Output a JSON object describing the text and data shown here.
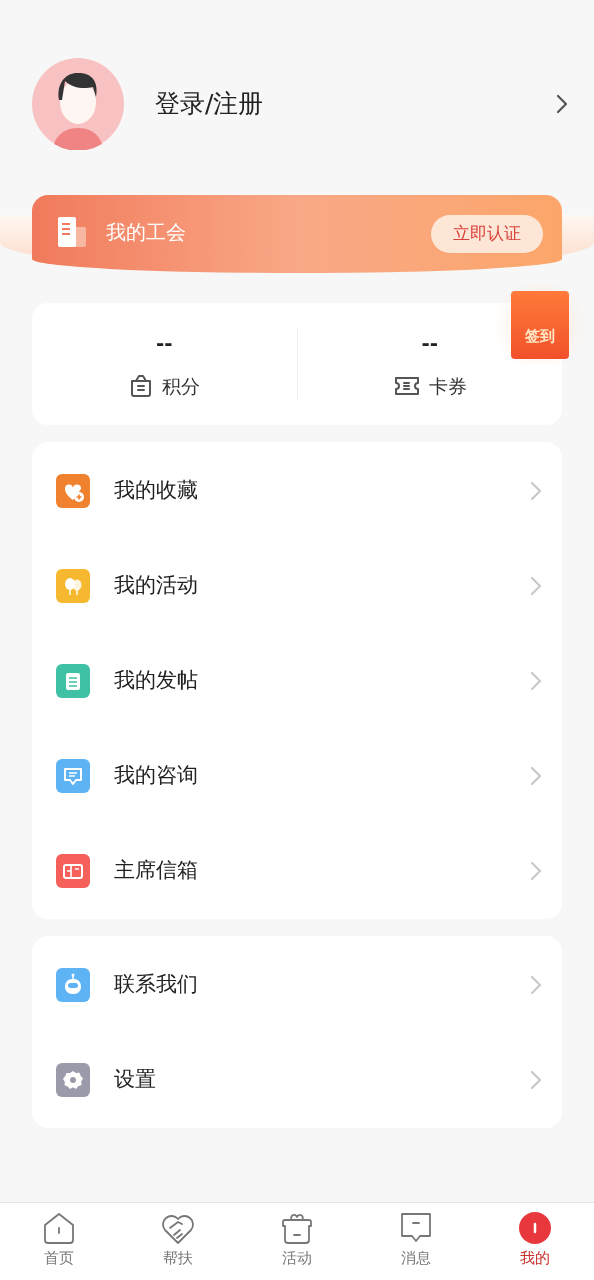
{
  "profile": {
    "login_label": "登录/注册"
  },
  "union_banner": {
    "title": "我的工会",
    "action": "立即认证"
  },
  "sign_in_badge": {
    "label": "签到"
  },
  "stats": [
    {
      "value": "--",
      "label": "积分",
      "kind": "bag"
    },
    {
      "value": "--",
      "label": "卡券",
      "kind": "ticket"
    }
  ],
  "menu_groups": [
    [
      {
        "label": "我的收藏",
        "kind": "heart",
        "color": "#f0812e"
      },
      {
        "label": "我的活动",
        "kind": "balloon",
        "color": "#f5b82e"
      },
      {
        "label": "我的发帖",
        "kind": "clipboard",
        "color": "#3fc1a5"
      },
      {
        "label": "我的咨询",
        "kind": "chat",
        "color": "#5eb3f5"
      },
      {
        "label": "主席信箱",
        "kind": "mailbox",
        "color": "#f5605a"
      }
    ],
    [
      {
        "label": "联系我们",
        "kind": "robot",
        "color": "#5eb3f5"
      },
      {
        "label": "设置",
        "kind": "gear",
        "color": "#9a9aaa"
      }
    ]
  ],
  "tab_bar": [
    {
      "label": "首页",
      "kind": "home",
      "selected": false
    },
    {
      "label": "帮扶",
      "kind": "handshake",
      "selected": false
    },
    {
      "label": "活动",
      "kind": "gift",
      "selected": false
    },
    {
      "label": "消息",
      "kind": "message",
      "selected": false
    },
    {
      "label": "我的",
      "kind": "me",
      "selected": true
    }
  ]
}
